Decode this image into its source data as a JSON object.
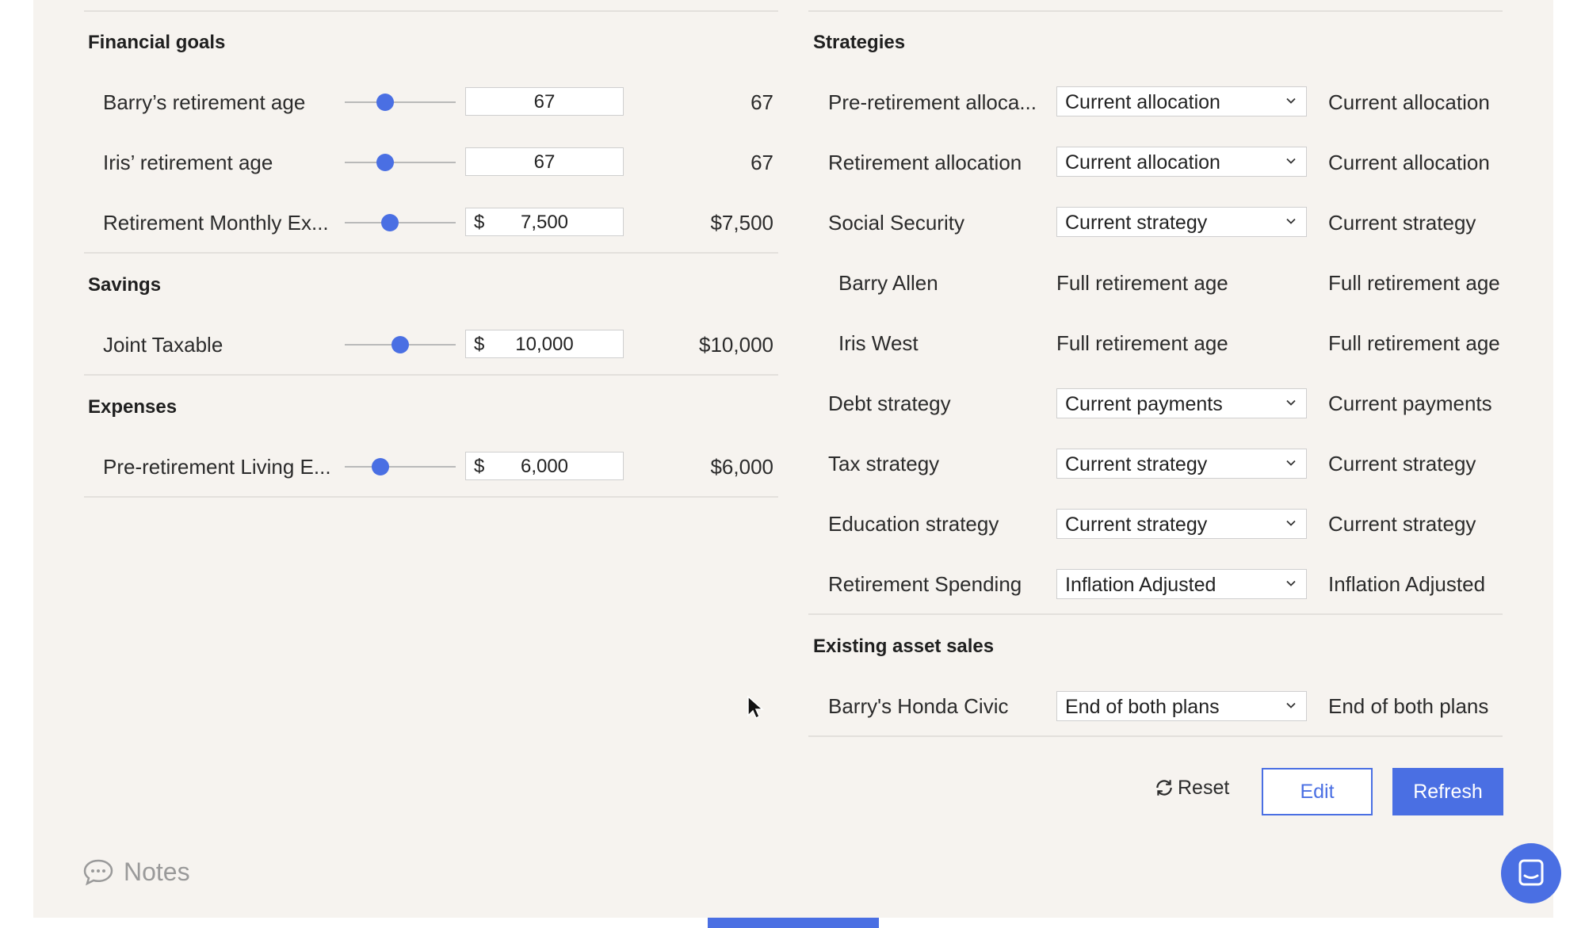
{
  "financial_goals": {
    "title": "Financial goals",
    "rows": [
      {
        "label": "Barry’s retirement age",
        "currency": "",
        "input": "67",
        "value": "67",
        "slider": 0.38
      },
      {
        "label": "Iris’ retirement age",
        "currency": "",
        "input": "67",
        "value": "67",
        "slider": 0.38
      },
      {
        "label": "Retirement Monthly Ex...",
        "currency": "$",
        "input": "7,500",
        "value": "$7,500",
        "slider": 0.42
      }
    ]
  },
  "savings": {
    "title": "Savings",
    "rows": [
      {
        "label": "Joint Taxable",
        "currency": "$",
        "input": "10,000",
        "value": "$10,000",
        "slider": 0.5
      }
    ]
  },
  "expenses": {
    "title": "Expenses",
    "rows": [
      {
        "label": "Pre-retirement Living E...",
        "currency": "$",
        "input": "6,000",
        "value": "$6,000",
        "slider": 0.33
      }
    ]
  },
  "strategies": {
    "title": "Strategies",
    "rows": [
      {
        "label": "Pre-retirement alloca...",
        "select": "Current allocation",
        "value": "Current allocation"
      },
      {
        "label": "Retirement allocation",
        "select": "Current allocation",
        "value": "Current allocation"
      },
      {
        "label": "Social Security",
        "select": "Current strategy",
        "value": "Current strategy"
      },
      {
        "label": "Barry Allen",
        "static": "Full retirement age",
        "value": "Full retirement age"
      },
      {
        "label": "Iris West",
        "static": "Full retirement age",
        "value": "Full retirement age"
      },
      {
        "label": "Debt strategy",
        "select": "Current payments",
        "value": "Current payments"
      },
      {
        "label": "Tax strategy",
        "select": "Current strategy",
        "value": "Current strategy"
      },
      {
        "label": "Education strategy",
        "select": "Current strategy",
        "value": "Current strategy"
      },
      {
        "label": "Retirement Spending",
        "select": "Inflation Adjusted",
        "value": "Inflation Adjusted"
      }
    ]
  },
  "existing_asset_sales": {
    "title": "Existing asset sales",
    "rows": [
      {
        "label": "Barry's Honda Civic",
        "select": "End of both plans",
        "value": "End of both plans"
      }
    ]
  },
  "actions": {
    "reset": "Reset",
    "edit": "Edit",
    "refresh": "Refresh"
  },
  "notes_label": "Notes",
  "colors": {
    "accent": "#4a6fe3",
    "panel_bg": "#f6f3ef"
  }
}
